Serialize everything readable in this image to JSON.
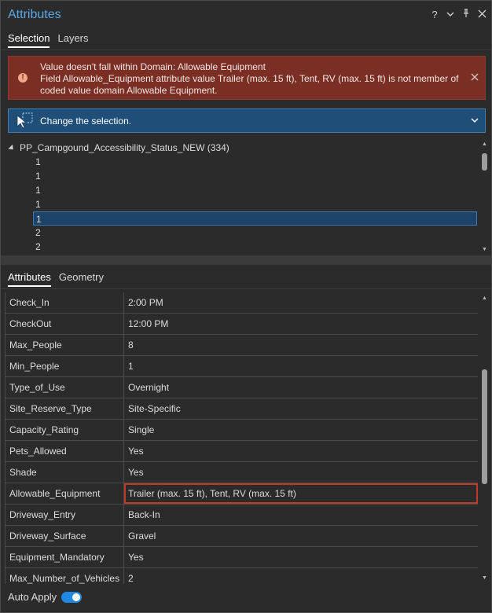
{
  "window": {
    "title": "Attributes",
    "icons": [
      "help-icon",
      "menu-chevron-icon",
      "pin-icon",
      "close-icon"
    ]
  },
  "top_tabs": [
    {
      "label": "Selection",
      "active": true
    },
    {
      "label": "Layers",
      "active": false
    }
  ],
  "error": {
    "line1": "Value doesn't fall within Domain: Allowable Equipment",
    "line2": "Field Allowable_Equipment attribute value Trailer (max. 15 ft), Tent, RV (max. 15 ft) is not member of",
    "line3": "coded value domain Allowable Equipment.",
    "icon": "error-icon",
    "color": "#7a2e24"
  },
  "change_selection": {
    "label": "Change the selection."
  },
  "tree": {
    "layer": "PP_Campgound_Accessibility_Status_NEW (334)",
    "rows": [
      {
        "label": "1",
        "selected": false
      },
      {
        "label": "1",
        "selected": false
      },
      {
        "label": "1",
        "selected": false
      },
      {
        "label": "1",
        "selected": false
      },
      {
        "label": "1",
        "selected": true
      },
      {
        "label": "2",
        "selected": false
      },
      {
        "label": "2",
        "selected": false
      }
    ]
  },
  "attr_tabs": [
    {
      "label": "Attributes",
      "active": true
    },
    {
      "label": "Geometry",
      "active": false
    }
  ],
  "attributes": [
    {
      "name": "Check_In",
      "value": "2:00 PM",
      "error": false
    },
    {
      "name": "CheckOut",
      "value": "12:00 PM",
      "error": false
    },
    {
      "name": "Max_People",
      "value": "8",
      "error": false
    },
    {
      "name": "Min_People",
      "value": "1",
      "error": false
    },
    {
      "name": "Type_of_Use",
      "value": "Overnight",
      "error": false
    },
    {
      "name": "Site_Reserve_Type",
      "value": "Site-Specific",
      "error": false
    },
    {
      "name": "Capacity_Rating",
      "value": "Single",
      "error": false
    },
    {
      "name": "Pets_Allowed",
      "value": "Yes",
      "error": false
    },
    {
      "name": "Shade",
      "value": "Yes",
      "error": false
    },
    {
      "name": "Allowable_Equipment",
      "value": "Trailer (max. 15 ft), Tent, RV (max. 15 ft)",
      "error": true
    },
    {
      "name": "Driveway_Entry",
      "value": "Back-In",
      "error": false
    },
    {
      "name": "Driveway_Surface",
      "value": "Gravel",
      "error": false
    },
    {
      "name": "Equipment_Mandatory",
      "value": "Yes",
      "error": false
    },
    {
      "name": "Max_Number_of_Vehicles",
      "value": "2",
      "error": false
    }
  ],
  "footer": {
    "auto_apply_label": "Auto Apply",
    "auto_apply_on": true
  },
  "colors": {
    "accent": "#1e88e5",
    "title": "#5aa9e6",
    "error_outline": "#c0392b",
    "selection_bar": "#1f4f78"
  }
}
